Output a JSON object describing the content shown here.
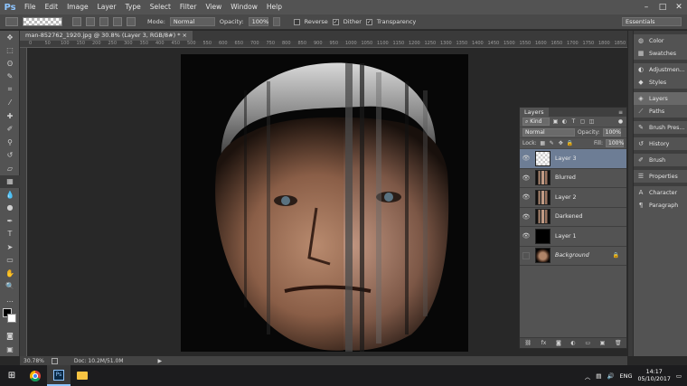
{
  "menu": {
    "items": [
      "File",
      "Edit",
      "Image",
      "Layer",
      "Type",
      "Select",
      "Filter",
      "View",
      "Window",
      "Help"
    ],
    "window_controls": [
      "–",
      "□",
      "✕"
    ]
  },
  "options": {
    "mode_label": "Mode:",
    "mode_value": "Normal",
    "opacity_label": "Opacity:",
    "opacity_value": "100%",
    "reverse_label": "Reverse",
    "dither_label": "Dither",
    "transparency_label": "Transparency",
    "reverse_checked": false,
    "dither_checked": true,
    "transparency_checked": true,
    "workspace_value": "Essentials"
  },
  "document": {
    "tab_title": "man-852762_1920.jpg @ 30.8% (Layer 3, RGB/8#) * ×"
  },
  "ruler": {
    "top_ticks": [
      "0",
      "50",
      "100",
      "150",
      "200",
      "250",
      "300",
      "350",
      "400",
      "450",
      "500",
      "550",
      "600",
      "650",
      "700",
      "750",
      "800",
      "850",
      "900",
      "950",
      "1000",
      "1050",
      "1100",
      "1150",
      "1200",
      "1250",
      "1300",
      "1350",
      "1400",
      "1450",
      "1500",
      "1550",
      "1600",
      "1650",
      "1700",
      "1750",
      "1800",
      "1850",
      "1900"
    ]
  },
  "status": {
    "zoom": "30.78%",
    "doc": "Doc: 10.2M/51.0M"
  },
  "layers_panel": {
    "tab_label": "Layers",
    "filter_kind": "Kind",
    "blend_mode": "Normal",
    "opacity_label": "Opacity:",
    "opacity_value": "100%",
    "lock_label": "Lock:",
    "fill_label": "Fill:",
    "fill_value": "100%",
    "layers": [
      {
        "name": "Layer 3",
        "visible": true,
        "selected": true,
        "thumb": "transparent"
      },
      {
        "name": "Blurred",
        "visible": true,
        "selected": false,
        "thumb": "strips"
      },
      {
        "name": "Layer 2",
        "visible": true,
        "selected": false,
        "thumb": "strips"
      },
      {
        "name": "Darkened",
        "visible": true,
        "selected": false,
        "thumb": "strips"
      },
      {
        "name": "Layer 1",
        "visible": true,
        "selected": false,
        "thumb": "black"
      },
      {
        "name": "Background",
        "visible": false,
        "selected": false,
        "thumb": "face",
        "locked": true
      }
    ],
    "footer_icons": [
      "link-icon",
      "fx-icon",
      "mask-icon",
      "adjustment-icon",
      "folder-icon",
      "new-layer-icon",
      "trash-icon"
    ]
  },
  "right_dock": {
    "group1": [
      {
        "label": "Color",
        "icon": "color-icon"
      },
      {
        "label": "Swatches",
        "icon": "swatches-icon"
      }
    ],
    "group2": [
      {
        "label": "Adjustmen...",
        "icon": "adjustments-icon"
      },
      {
        "label": "Styles",
        "icon": "styles-icon"
      }
    ],
    "group3": [
      {
        "label": "Layers",
        "icon": "layers-icon"
      },
      {
        "label": "Paths",
        "icon": "paths-icon"
      }
    ],
    "group4": [
      {
        "label": "Brush Pres...",
        "icon": "brush-presets-icon"
      }
    ],
    "group5": [
      {
        "label": "History",
        "icon": "history-icon"
      }
    ],
    "group6": [
      {
        "label": "Brush",
        "icon": "brush-icon"
      }
    ],
    "group7": [
      {
        "label": "Properties",
        "icon": "properties-icon"
      }
    ],
    "group8": [
      {
        "label": "Character",
        "icon": "character-icon"
      },
      {
        "label": "Paragraph",
        "icon": "paragraph-icon"
      }
    ]
  },
  "taskbar": {
    "language": "ENG",
    "time": "14:17",
    "date": "05/10/2017"
  },
  "colors": {
    "selected_layer": "#6d7d95",
    "ps_blue": "#8ec5ff"
  }
}
